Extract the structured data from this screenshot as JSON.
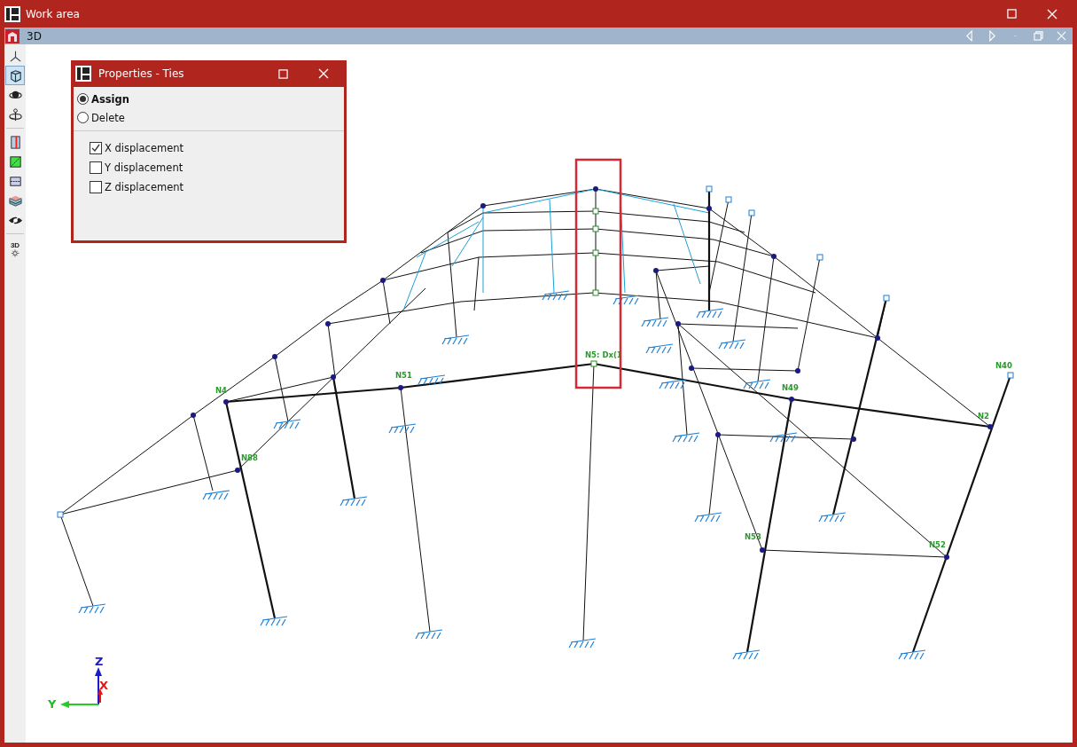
{
  "window": {
    "title": "Work area"
  },
  "view_bar": {
    "title": "3D"
  },
  "toolbar_groups": [
    [
      {
        "kind": "axes",
        "selected": false
      },
      {
        "kind": "cube",
        "selected": true
      },
      {
        "kind": "orbit",
        "selected": false
      },
      {
        "kind": "pivot",
        "selected": false
      }
    ],
    [
      {
        "kind": "section",
        "selected": false
      },
      {
        "kind": "plane",
        "selected": false
      },
      {
        "kind": "band",
        "selected": false
      },
      {
        "kind": "layers",
        "selected": false
      },
      {
        "kind": "hide",
        "selected": false
      }
    ],
    [
      {
        "kind": "view3d",
        "label": "3D",
        "selected": false
      }
    ]
  ],
  "properties_panel": {
    "title": "Properties - Ties",
    "modes": [
      {
        "label": "Assign",
        "selected": true
      },
      {
        "label": "Delete",
        "selected": false
      }
    ],
    "options": [
      {
        "label": "X displacement",
        "checked": true
      },
      {
        "label": "Y displacement",
        "checked": false
      },
      {
        "label": "Z displacement",
        "checked": false
      }
    ]
  },
  "node_labels": [
    "N4",
    "N51",
    "N88",
    "N5: Dx(1",
    "N49",
    "N40",
    "N2",
    "N53",
    "N52"
  ],
  "axes": {
    "z": "Z",
    "x": "X",
    "y": "Y"
  }
}
